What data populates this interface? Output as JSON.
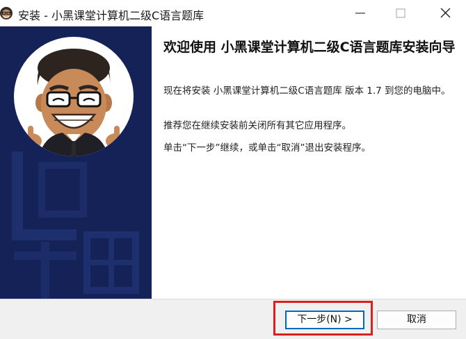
{
  "window": {
    "title": "安装 - 小黑课堂计算机二级C语言题库",
    "icon": "avatar-app-icon",
    "controls": [
      "minimize-icon",
      "maximize-icon",
      "close-icon"
    ]
  },
  "sidebar": {
    "background_color": "#142258",
    "image": "cartoon-avatar-glasses-thumbs-up"
  },
  "content": {
    "heading": "欢迎使用 小黑课堂计算机二级C语言题库安装向导",
    "paragraph1": "现在将安装 小黑课堂计算机二级C语言题库 版本 1.7 到您的电脑中。",
    "paragraph2": "推荐您在继续安装前关闭所有其它应用程序。",
    "paragraph3": "单击“下一步”继续，或单击“取消”退出安装程序。"
  },
  "footer": {
    "next_label": "下一步(N) >",
    "cancel_label": "取消",
    "highlight_color": "#d9201c",
    "focus_color": "#0067c0"
  }
}
